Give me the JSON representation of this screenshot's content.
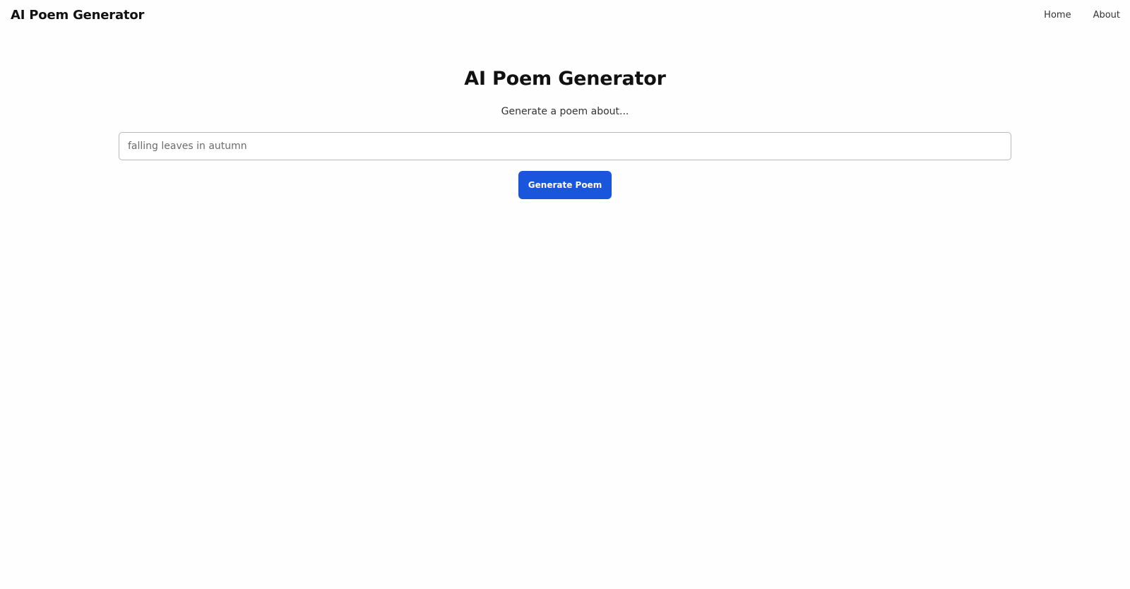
{
  "header": {
    "brand": "AI Poem Generator",
    "nav": [
      {
        "label": "Home"
      },
      {
        "label": "About"
      }
    ]
  },
  "main": {
    "title": "AI Poem Generator",
    "subtitle": "Generate a poem about...",
    "input": {
      "value": "",
      "placeholder": "falling leaves in autumn"
    },
    "button_label": "Generate Poem"
  },
  "colors": {
    "accent": "#1a56db",
    "background": "#fefefe"
  }
}
